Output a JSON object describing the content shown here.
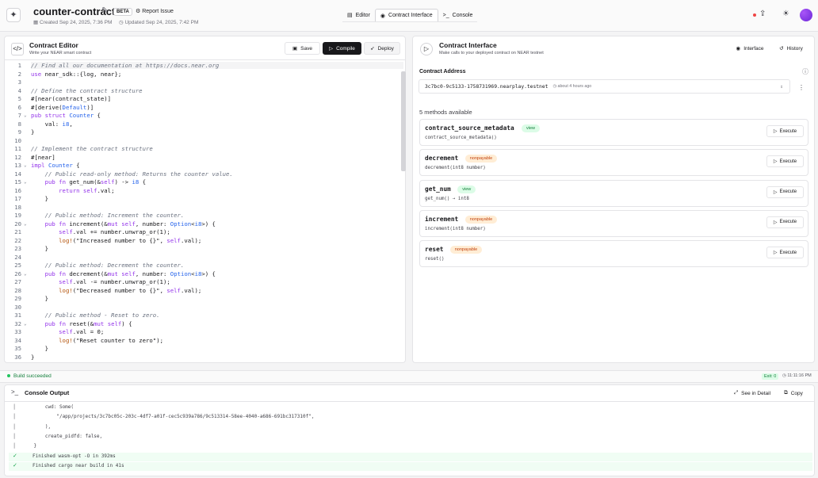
{
  "header": {
    "title": "counter-contract",
    "beta": "BETA",
    "report": "Report Issue",
    "created": "Created Sep 24, 2025, 7:36 PM",
    "updated": "Updated Sep 24, 2025, 7:42 PM",
    "tabs": [
      {
        "label": "Editor",
        "icon": "file-icon"
      },
      {
        "label": "Contract Interface",
        "icon": "play-circle-icon"
      },
      {
        "label": "Console",
        "icon": "terminal-icon"
      }
    ]
  },
  "editor": {
    "title": "Contract Editor",
    "subtitle": "Write your NEAR smart contract",
    "save": "Save",
    "compile": "Compile",
    "deploy": "Deploy",
    "lines": [
      "// Find all our documentation at https://docs.near.org",
      "use near_sdk::{log, near};",
      "",
      "// Define the contract structure",
      "#[near(contract_state)]",
      "#[derive(Default)]",
      "pub struct Counter {",
      "    val: i8,",
      "}",
      "",
      "// Implement the contract structure",
      "#[near]",
      "impl Counter {",
      "    // Public read-only method: Returns the counter value.",
      "    pub fn get_num(&self) -> i8 {",
      "        return self.val;",
      "    }",
      "",
      "    // Public method: Increment the counter.",
      "    pub fn increment(&mut self, number: Option<i8>) {",
      "        self.val += number.unwrap_or(1);",
      "        log!(\"Increased number to {}\", self.val);",
      "    }",
      "",
      "    // Public method: Decrement the counter.",
      "    pub fn decrement(&mut self, number: Option<i8>) {",
      "        self.val -= number.unwrap_or(1);",
      "        log!(\"Decreased number to {}\", self.val);",
      "    }",
      "",
      "    // Public method - Reset to zero.",
      "    pub fn reset(&mut self) {",
      "        self.val = 0;",
      "        log!(\"Reset counter to zero\");",
      "    }",
      "}"
    ]
  },
  "interface": {
    "title": "Contract Interface",
    "subtitle": "Make calls to your deployed contract on NEAR testnet",
    "interface_btn": "Interface",
    "history_btn": "History",
    "address_label": "Contract Address",
    "address": "3c7bc0-9c5133-1758731969.nearplay.testnet",
    "address_time": "about 4 hours ago",
    "methods_count": "5 methods available",
    "execute": "Execute",
    "methods": [
      {
        "name": "contract_source_metadata",
        "badge": "view",
        "sig": "contract_source_metadata()"
      },
      {
        "name": "decrement",
        "badge": "nonpayable",
        "sig": "decrement(int8 number)"
      },
      {
        "name": "get_num",
        "badge": "view",
        "sig": "get_num() → int8"
      },
      {
        "name": "increment",
        "badge": "nonpayable",
        "sig": "increment(int8 number)"
      },
      {
        "name": "reset",
        "badge": "nonpayable",
        "sig": "reset()"
      }
    ]
  },
  "status": {
    "build": "Build succeeded",
    "exit": "Exit: 0",
    "time": "11:11:16 PM"
  },
  "console": {
    "title": "Console Output",
    "see_detail": "See in Detail",
    "copy": "Copy",
    "lines": [
      "        cwd: Some(",
      "            \"/app/projects/3c7bc05c-203c-4df7-a01f-cec5c939a786/9c513314-58ee-4040-a686-691bc317310f\",",
      "        ),",
      "        create_pidfd: false,",
      "    }"
    ],
    "ok_lines": [
      "Finished wasm-opt -O in 392ms",
      "Finished cargo near build in 41s"
    ]
  },
  "colors": {
    "view": "#15803d",
    "nonpayable": "#c2410c",
    "success": "#22c55e"
  }
}
